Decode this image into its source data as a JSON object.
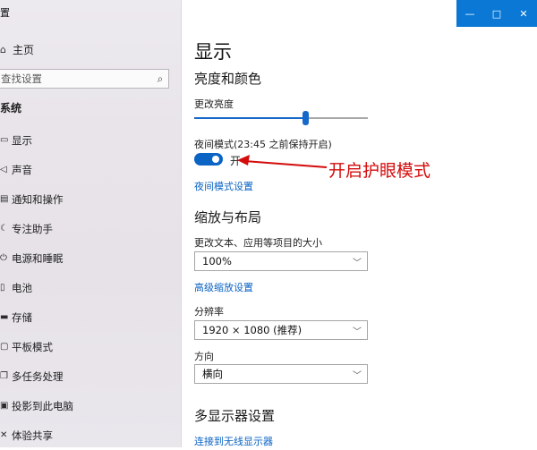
{
  "sidebar": {
    "title": "置",
    "home_label": "主页",
    "search_placeholder": "查找设置",
    "section_label": "系统",
    "items": [
      {
        "label": "显示",
        "icon": "monitor-icon"
      },
      {
        "label": "声音",
        "icon": "speaker-icon"
      },
      {
        "label": "通知和操作",
        "icon": "notification-icon"
      },
      {
        "label": "专注助手",
        "icon": "moon-icon"
      },
      {
        "label": "电源和睡眠",
        "icon": "power-icon"
      },
      {
        "label": "电池",
        "icon": "battery-icon"
      },
      {
        "label": "存储",
        "icon": "storage-icon"
      },
      {
        "label": "平板模式",
        "icon": "tablet-icon"
      },
      {
        "label": "多任务处理",
        "icon": "multitask-icon"
      },
      {
        "label": "投影到此电脑",
        "icon": "project-icon"
      },
      {
        "label": "体验共享",
        "icon": "share-icon"
      }
    ]
  },
  "window": {
    "minimize": "—",
    "maximize": "□",
    "close": "✕"
  },
  "main": {
    "title": "显示",
    "brightness_heading": "亮度和颜色",
    "brightness_label": "更改亮度",
    "brightness_value": 0.64,
    "night_mode_label": "夜间模式(23:45 之前保持开启)",
    "night_mode_state": "开",
    "night_mode_on": true,
    "night_mode_link": "夜间模式设置",
    "scale_heading": "缩放与布局",
    "scale_label": "更改文本、应用等项目的大小",
    "scale_value": "100%",
    "advanced_scale_link": "高级缩放设置",
    "resolution_label": "分辨率",
    "resolution_value": "1920 × 1080 (推荐)",
    "orientation_label": "方向",
    "orientation_value": "横向",
    "multi_display_heading": "多显示器设置",
    "wireless_link": "连接到无线显示器"
  },
  "annotation": {
    "text": "开启护眼模式",
    "color": "#d40b0b"
  }
}
